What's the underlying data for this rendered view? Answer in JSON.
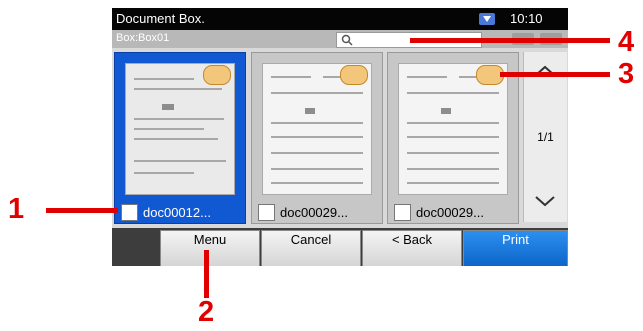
{
  "window": {
    "title": "Document Box.",
    "clock": "10:10"
  },
  "box": {
    "name": "Box:Box01"
  },
  "documents": [
    {
      "name": "doc00012...",
      "selected": true
    },
    {
      "name": "doc00029...",
      "selected": false
    },
    {
      "name": "doc00029...",
      "selected": false
    }
  ],
  "pager": {
    "page": "1/1"
  },
  "buttons": {
    "menu": "Menu",
    "cancel": "Cancel",
    "back": "< Back",
    "print": "Print"
  },
  "callouts": {
    "c1": "1",
    "c2": "2",
    "c3": "3",
    "c4": "4"
  },
  "colors": {
    "selected": "#1158d3",
    "print_button": "#1a78e0",
    "callout": "#e00000",
    "title_bar": "#050505"
  },
  "icons": [
    "status-icon",
    "search-icon",
    "scroll-up-icon",
    "scroll-down-icon",
    "checkbox-icon"
  ]
}
